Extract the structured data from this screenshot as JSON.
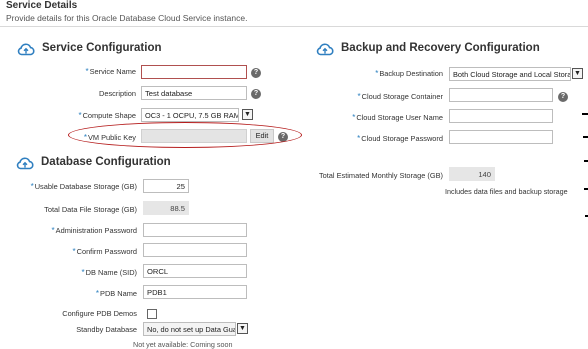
{
  "page": {
    "title": "Service Details",
    "subtitle": "Provide details for this Oracle Database Cloud Service instance."
  },
  "service_config": {
    "title": "Service Configuration",
    "service_name": {
      "label": "Service Name",
      "value": ""
    },
    "description": {
      "label": "Description",
      "value": "Test database"
    },
    "compute_shape": {
      "label": "Compute Shape",
      "value": "OC3 - 1 OCPU, 7.5 GB RAM"
    },
    "vm_public_key": {
      "label": "VM Public Key",
      "value": "",
      "edit_label": "Edit"
    }
  },
  "database_config": {
    "title": "Database Configuration",
    "usable_storage": {
      "label": "Usable Database Storage (GB)",
      "value": "25"
    },
    "total_data_storage": {
      "label": "Total Data File Storage (GB)",
      "value": "88.5"
    },
    "admin_password": {
      "label": "Administration Password",
      "value": ""
    },
    "confirm_password": {
      "label": "Confirm Password",
      "value": ""
    },
    "db_name": {
      "label": "DB Name (SID)",
      "value": "ORCL"
    },
    "pdb_name": {
      "label": "PDB Name",
      "value": "PDB1"
    },
    "configure_pdb_demos": {
      "label": "Configure PDB Demos"
    },
    "standby_database": {
      "label": "Standby Database",
      "value": "No, do not set up Data Guard"
    },
    "footer_text": "Not yet available: Coming soon"
  },
  "backup_config": {
    "title": "Backup and Recovery Configuration",
    "backup_destination": {
      "label": "Backup Destination",
      "value": "Both Cloud Storage and Local Storage"
    },
    "cloud_storage_container": {
      "label": "Cloud Storage Container",
      "value": ""
    },
    "cloud_storage_user": {
      "label": "Cloud Storage User Name",
      "value": ""
    },
    "cloud_storage_password": {
      "label": "Cloud Storage Password",
      "value": ""
    },
    "total_monthly_storage": {
      "label": "Total Estimated Monthly Storage (GB)",
      "value": "140"
    },
    "note": "Includes data files and backup storage"
  },
  "icons": {
    "help": "?",
    "chevron_down": "▼"
  },
  "colors": {
    "required_asterisk": "#2a7fbf",
    "error_border": "#b0504f",
    "highlight_ellipse": "#b51c1c",
    "cloud_icon": "#2f7fc0"
  }
}
